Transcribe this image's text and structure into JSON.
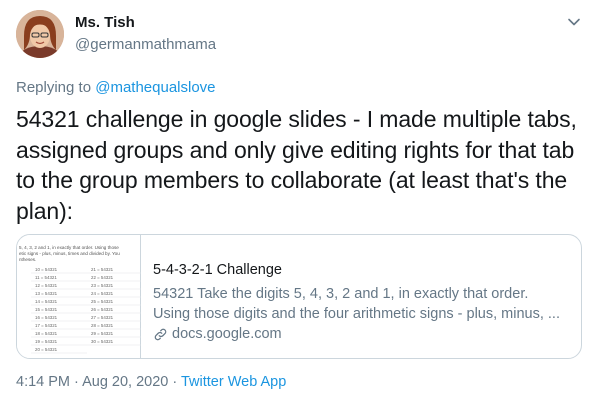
{
  "author": {
    "name": "Ms. Tish",
    "handle": "@germanmathmama"
  },
  "reply": {
    "prefix": "Replying to",
    "mention": "@mathequalslove"
  },
  "tweet": {
    "text": "54321 challenge in google slides - I made multiple tabs, assigned groups and only give editing rights for that tab to the group members to collaborate (at least that's the plan):"
  },
  "card": {
    "thumbnail": {
      "line1": "5, 4, 3, 2 and 1, in exactly that order. Using those",
      "line2": "etic signs - plus, minus, times and divided by. You",
      "line3": "ntheses.",
      "rows_left": [
        "10 = 54321",
        "11 = 54321",
        "12 = 54321",
        "13 = 54321",
        "14 = 54321",
        "15 = 54321",
        "16 = 54321",
        "17 = 54321",
        "18 = 54321",
        "19 = 54321",
        "20 = 54321"
      ],
      "rows_right": [
        "21 = 54321",
        "22 = 54321",
        "23 = 54321",
        "24 = 54321",
        "25 = 54321",
        "26 = 54321",
        "27 = 54321",
        "28 = 54321",
        "29 = 54321",
        "30 = 54321"
      ]
    },
    "title": "5-4-3-2-1 Challenge",
    "description_line1": "54321 Take the digits 5, 4, 3, 2 and 1, in exactly that order.",
    "description_line2": "Using those digits and the four arithmetic signs - plus, minus, ...",
    "domain": "docs.google.com"
  },
  "meta": {
    "time": "4:14 PM",
    "separator1": " · ",
    "date": "Aug 20, 2020",
    "separator2": " · ",
    "source": "Twitter Web App"
  },
  "colors": {
    "link": "#1b95e0",
    "secondary": "#657786",
    "border": "#ccd6dd"
  },
  "icons": [
    "avatar",
    "chevron-down-icon",
    "link-icon"
  ]
}
